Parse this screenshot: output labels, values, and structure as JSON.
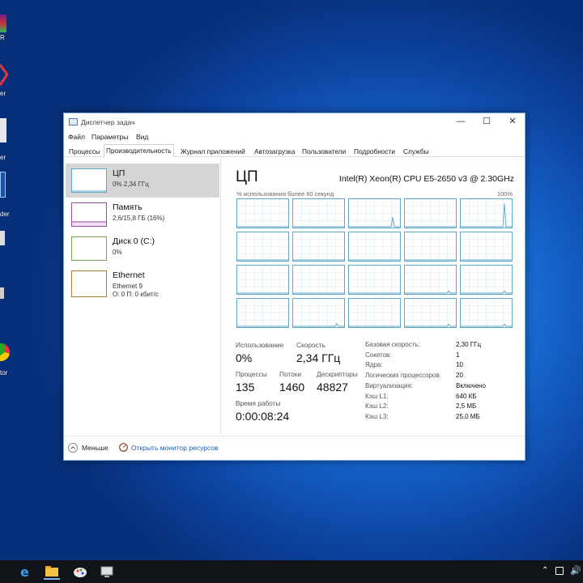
{
  "desktop": {
    "labels": [
      "R",
      "er",
      "er",
      "der",
      "tor"
    ]
  },
  "window": {
    "title": "Диспетчер задач",
    "controls": {
      "minimize": "—",
      "maximize": "☐",
      "close": "✕"
    }
  },
  "menu": [
    "Файл",
    "Параметры",
    "Вид"
  ],
  "tabs": [
    "Процессы",
    "Производительность",
    "Журнал приложений",
    "Автозагрузка",
    "Пользователи",
    "Подробности",
    "Службы"
  ],
  "active_tab": "Производительность",
  "sidebar": {
    "items": [
      {
        "name": "ЦП",
        "line1": "0% 2,34 ГГц",
        "line2": ""
      },
      {
        "name": "Память",
        "line1": "2,6/15,8 ГБ (16%)",
        "line2": ""
      },
      {
        "name": "Диск 0 (C:)",
        "line1": "0%",
        "line2": ""
      },
      {
        "name": "Ethernet",
        "line1": "Ethernet 9",
        "line2": "О: 0 П: 0 кбит/с"
      }
    ],
    "colors": {
      "cpu": "#5ea9c7",
      "memory": "#9b4ea8",
      "disk": "#6aa84f",
      "ethernet": "#b07b3a"
    }
  },
  "cpu": {
    "title": "ЦП",
    "model": "Intel(R) Xeon(R) CPU E5-2650 v3 @ 2.30GHz",
    "graph_caption": "% использования более 60 секунд",
    "graph_max": "100%",
    "stats": {
      "usage_label": "Использование",
      "usage_value": "0%",
      "speed_label": "Скорость",
      "speed_value": "2,34 ГГц",
      "processes_label": "Процессы",
      "processes_value": "135",
      "threads_label": "Потоки",
      "threads_value": "1460",
      "handles_label": "Дескрипторы",
      "handles_value": "48827",
      "uptime_label": "Время работы",
      "uptime_value": "0:00:08:24"
    },
    "details": [
      {
        "k": "Базовая скорость:",
        "v": "2,30 ГГц"
      },
      {
        "k": "Сокетов:",
        "v": "1"
      },
      {
        "k": "Ядра:",
        "v": "10"
      },
      {
        "k": "Логических процессоров:",
        "v": "20"
      },
      {
        "k": "Виртуализация:",
        "v": "Включено"
      },
      {
        "k": "Кэш L1:",
        "v": "640 КБ"
      },
      {
        "k": "Кэш L2:",
        "v": "2,5 МБ"
      },
      {
        "k": "Кэш L3:",
        "v": "25,0 МБ"
      }
    ],
    "core_peaks": [
      [
        0,
        0,
        0.35,
        0,
        0.85
      ],
      [
        0,
        0,
        0,
        0,
        0
      ],
      [
        0,
        0,
        0,
        0.08,
        0.08
      ],
      [
        0,
        0.1,
        0,
        0.08,
        0.08
      ]
    ]
  },
  "footer": {
    "less_label": "Меньше",
    "monitor_link": "Открыть монитор ресурсов"
  },
  "taskbar": {
    "icons": [
      "edge-icon",
      "file-explorer-icon",
      "paint-icon",
      "computer-icon"
    ]
  }
}
